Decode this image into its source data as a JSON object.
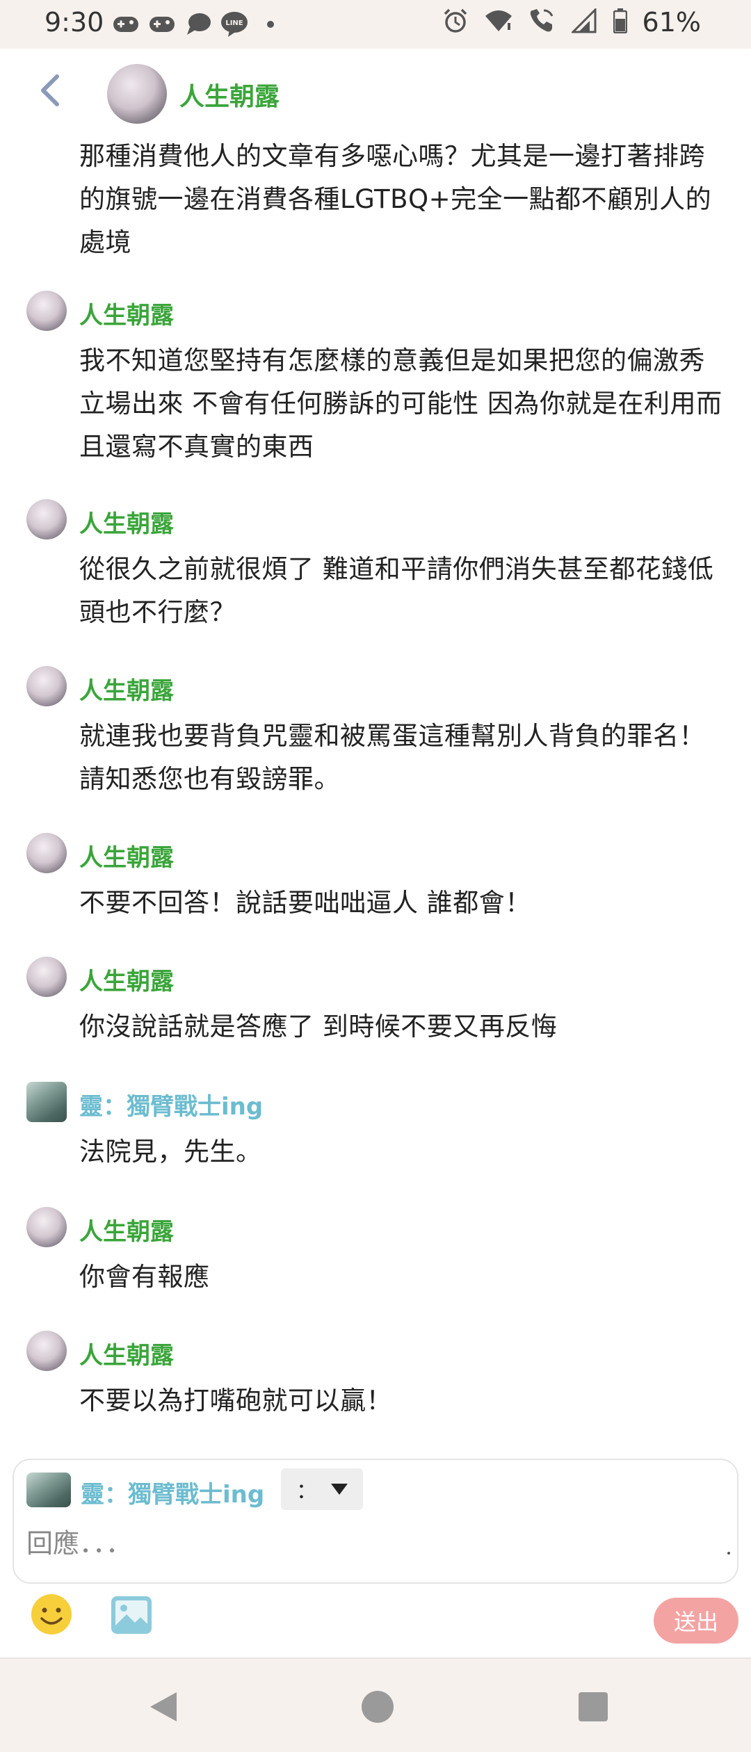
{
  "status_bar": {
    "time": "9:30",
    "battery": "61%",
    "left_icons": [
      "gamepad-icon",
      "gamepad-icon",
      "chat-bubble-icon",
      "line-app-icon",
      "dot-icon"
    ],
    "line_icon_text": "LINE",
    "right_icons": [
      "alarm-icon",
      "wifi-icon",
      "wifi-calling-icon",
      "signal-icon",
      "battery-icon"
    ]
  },
  "header": {
    "title": "人生朝露"
  },
  "messages": [
    {
      "author": "",
      "spirit": false,
      "text": "那種消費他人的文章有多噁心嗎？尤其是一邊打著排跨的旗號一邊在消費各種LGTBQ+完全一點都不顧別人的處境"
    },
    {
      "author": "人生朝露",
      "spirit": false,
      "text": "我不知道您堅持有怎麼樣的意義但是如果把您的偏激秀立場出來 不會有任何勝訴的可能性 因為你就是在利用而且還寫不真實的東西"
    },
    {
      "author": "人生朝露",
      "spirit": false,
      "text": "從很久之前就很煩了 難道和平請你們消失甚至都花錢低頭也不行麼？"
    },
    {
      "author": "人生朝露",
      "spirit": false,
      "text": "就連我也要背負咒靈和被罵蛋這種幫別人背負的罪名！請知悉您也有毀謗罪。"
    },
    {
      "author": "人生朝露",
      "spirit": false,
      "text": "不要不回答！說話要咄咄逼人 誰都會！"
    },
    {
      "author": "人生朝露",
      "spirit": false,
      "text": "你沒說話就是答應了 到時候不要又再反悔"
    },
    {
      "author": "靈：獨臂戰士ing",
      "spirit": true,
      "text": "法院見，先生。"
    },
    {
      "author": "人生朝露",
      "spirit": false,
      "text": "你會有報應"
    },
    {
      "author": "人生朝露",
      "spirit": false,
      "text": "不要以為打嘴砲就可以贏！"
    }
  ],
  "compose": {
    "identity": "靈：獨臂戰士ing",
    "separator": "：",
    "placeholder": "回應．．．",
    "send_label": "送出"
  },
  "colors": {
    "author_green": "#3aa53a",
    "spirit_blue": "#6cbcd0",
    "send_button": "#f4a3a3",
    "status_bar_bg": "#f7f1ee"
  }
}
